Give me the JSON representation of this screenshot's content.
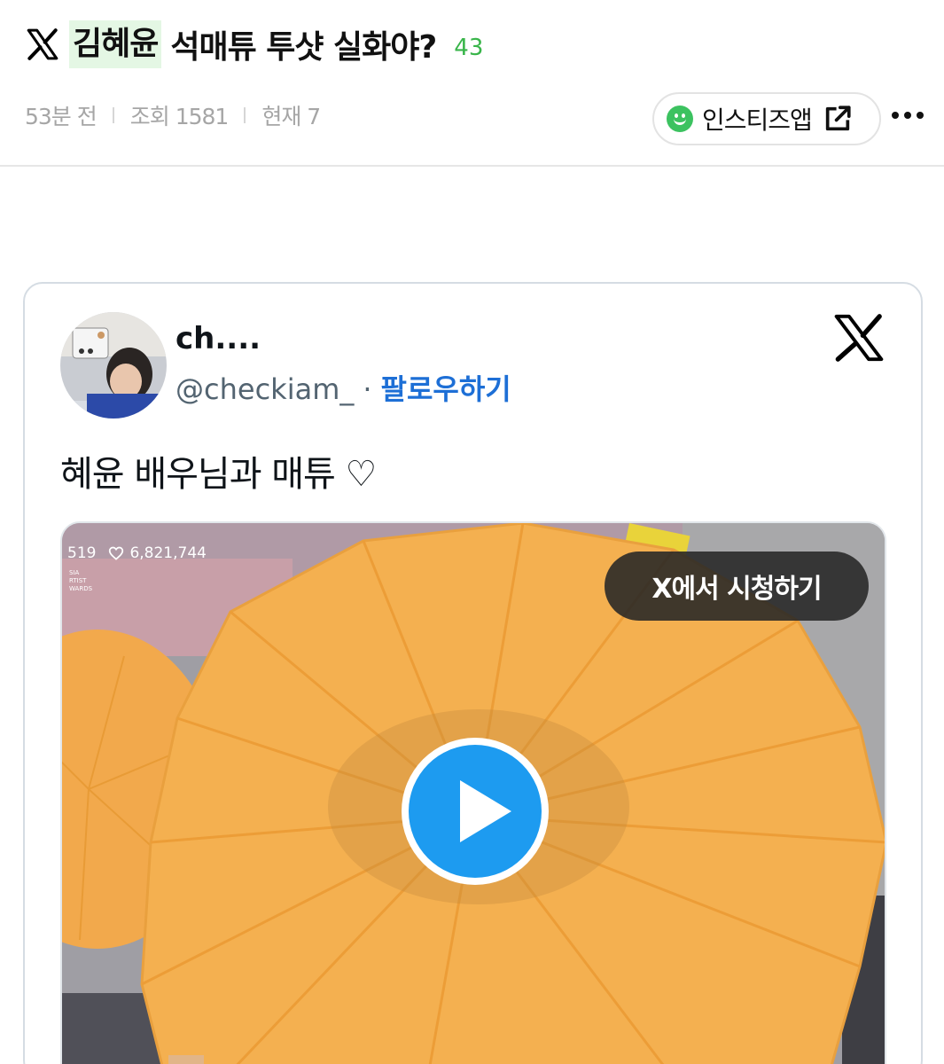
{
  "post": {
    "title_highlight": "김혜윤",
    "title_rest": "석매튜 투샷 실화야?",
    "comment_count": "43",
    "time_ago": "53분 전",
    "views": "조회 1581",
    "now_viewing": "현재 7",
    "app_link_label": "인스티즈앱"
  },
  "tweet": {
    "user_name": "ch....",
    "handle": "@checkiam_",
    "separator": "·",
    "follow_label": "팔로우하기",
    "text": "혜윤 배우님과 매튜 ♡",
    "media": {
      "overlay_count": "519",
      "overlay_likes": "6,821,744",
      "overlay_tiny": "SIA\nRTIST\nWARDS",
      "watch_label": "X에서 시청하기"
    }
  },
  "colors": {
    "highlight_bg": "#e4f7e4",
    "comment_green": "#39b54a",
    "follow_blue": "#1d6fd6",
    "play_blue": "#1d9bf0",
    "umbrella_orange": "#f3ad4a"
  },
  "icons": [
    "x-logo-icon",
    "smile-icon",
    "external-link-icon",
    "more-icon",
    "heart-icon",
    "play-icon"
  ]
}
